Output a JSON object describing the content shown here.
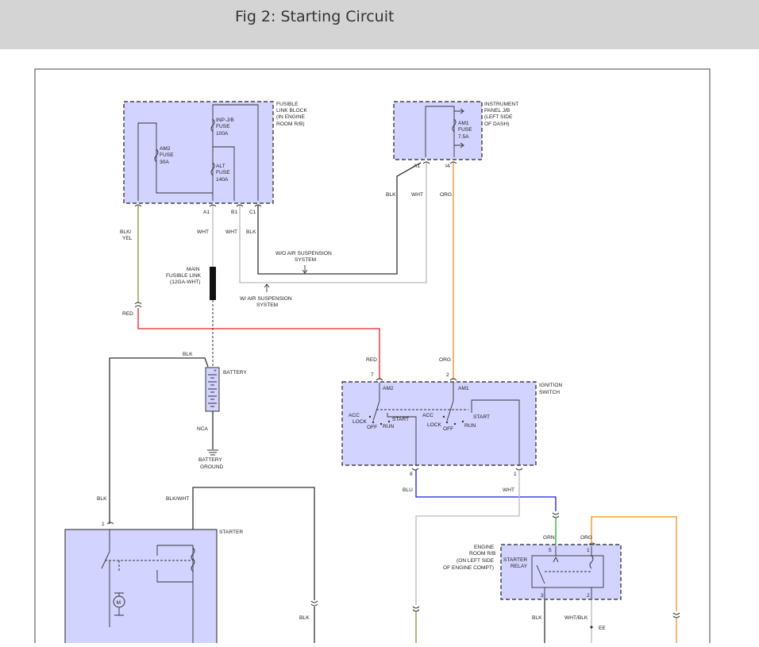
{
  "header": {
    "title": "Fig 2: Starting Circuit"
  },
  "colors": {
    "header_bg": "#d4d4d4",
    "component_fill": "#d3d3ff",
    "red_wire": "#e62020",
    "org_wire": "#f0901c",
    "blu_wire": "#1a1ae6",
    "grn_wire": "#2ea82e",
    "wht_wire": "#bbbbbb",
    "blk_wire": "#333333",
    "yel_wire": "#8a8f3a"
  },
  "labels": {
    "fusible_link_block": [
      "FUSIBLE",
      "LINK BLOCK",
      "(IN ENGINE",
      "ROOM R/B)"
    ],
    "inp_jb_fuse": [
      "INP-J/B",
      "FUSE",
      "100A"
    ],
    "am2_fuse": [
      "AM2",
      "FUSE",
      "30A"
    ],
    "alt_fuse": [
      "ALT",
      "FUSE",
      "140A"
    ],
    "instrument_panel": [
      "INSTRUMENT",
      "PANEL J/B",
      "(LEFT SIDE",
      "OF DASH)"
    ],
    "am1_fuse": [
      "AM1",
      "FUSE",
      "7.5A"
    ],
    "pins": {
      "a1_left": "A1",
      "b1": "B1",
      "c1": "C1",
      "a1_right": "A1",
      "i4": "I4",
      "ign_7": "7",
      "ign_2": "2",
      "ign_8": "8",
      "ign_1": "1",
      "starter_1": "1",
      "relay_5": "5",
      "relay_1": "1",
      "relay_3": "3",
      "relay_2": "2"
    },
    "wires": {
      "blk_yel": [
        "BLK/",
        "YEL"
      ],
      "wht_a": "WHT",
      "wht_b": "WHT",
      "blk_c1": "BLK",
      "blk_top": "BLK",
      "wht_top": "WHT",
      "org_top": "ORG",
      "red_left": "RED",
      "red_ign": "RED",
      "org_ign": "ORG",
      "blk_batt": "BLK",
      "nca": "NCA",
      "blu": "BLU",
      "wht_ign": "WHT",
      "blk_starter": "BLK",
      "blk_wht": "BLK/WHT",
      "grn": "GRN",
      "org_relay": "ORG",
      "blk_bottom": "BLK",
      "wht_blk": "WHT/BLK"
    },
    "wo_air": [
      "W/O AIR SUSPENSION",
      "SYSTEM"
    ],
    "w_air": [
      "W/ AIR SUSPENSION",
      "SYSTEM"
    ],
    "main_fusible_link": [
      "MAIN",
      "FUSIBLE LINK",
      "(12GA-WHT)"
    ],
    "battery": "BATTERY",
    "battery_ground": [
      "BATTERY",
      "GROUND"
    ],
    "ignition_switch": [
      "IGNITION",
      "SWITCH"
    ],
    "am2": "AM2",
    "am1": "AM1",
    "acc_1": "ACC",
    "lock_1": "LOCK",
    "off_1": "OFF",
    "start_1": "START",
    "run_1": "RUN",
    "acc_2": "ACC",
    "lock_2": "LOCK",
    "off_2": "OFF",
    "start_2": "START",
    "run_2": "RUN",
    "starter": "STARTER",
    "motor": "M",
    "engine_room_rb": [
      "ENGINE",
      "ROOM R/B",
      "(ON LEFT SIDE",
      "OF ENGINE COMPT)"
    ],
    "starter_relay": [
      "STARTER",
      "RELAY"
    ],
    "ee": "EE"
  }
}
